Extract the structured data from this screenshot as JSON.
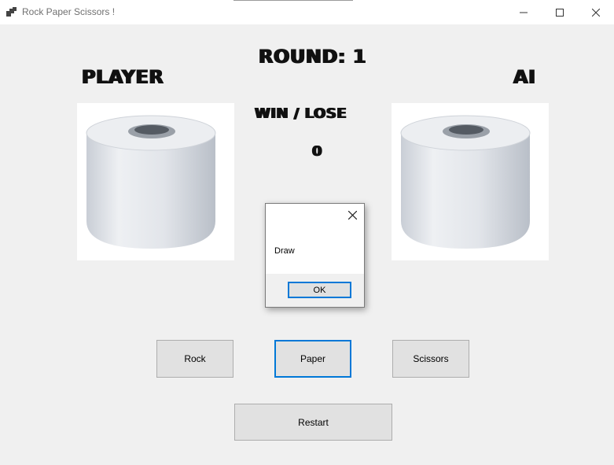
{
  "window": {
    "title": "Rock Paper Scissors !",
    "icon": "app-icon",
    "controls": [
      "minimize-icon",
      "maximize-icon",
      "close-icon"
    ]
  },
  "game": {
    "round_label": "ROUND: 1",
    "player_label": "PLAYER",
    "ai_label": "AI",
    "result_label": "WIN / LOSE",
    "score": "0",
    "player_choice_image": "toilet-paper-roll",
    "ai_choice_image": "toilet-paper-roll"
  },
  "buttons": {
    "rock": "Rock",
    "paper": "Paper",
    "scissors": "Scissors",
    "restart": "Restart"
  },
  "dialog": {
    "message": "Draw",
    "ok_label": "OK"
  },
  "colors": {
    "accent": "#0078d7",
    "background": "#f0f0f0",
    "button": "#e1e1e1"
  }
}
